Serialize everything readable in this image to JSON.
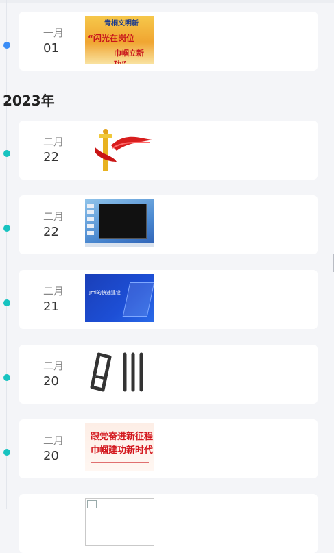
{
  "year_heading": "2023年",
  "entries": [
    {
      "month": "一月",
      "day": "01",
      "thumb": "poster-flash-post",
      "thumb_text_top": "青桐文明新",
      "thumb_text_main1": "“闪光在岗位",
      "thumb_text_main2": "巾帼立新功”"
    },
    {
      "month": "二月",
      "day": "22",
      "thumb": "huabiao-ribbon-icon"
    },
    {
      "month": "二月",
      "day": "22",
      "thumb": "desktop-terminal-screenshot"
    },
    {
      "month": "二月",
      "day": "21",
      "thumb": "blue-presentation-slide",
      "thumb_text": "Jmi的快速建设"
    },
    {
      "month": "二月",
      "day": "20",
      "thumb": "books-icon"
    },
    {
      "month": "二月",
      "day": "20",
      "thumb": "red-banner-poster",
      "thumb_text_line1": "跟党奋进新征程",
      "thumb_text_line2": "巾帼建功新时代"
    },
    {
      "month": "",
      "day": "",
      "thumb": "broken-image-icon"
    }
  ],
  "colors": {
    "accent_blue": "#3b8df6",
    "accent_teal": "#17c3c0"
  }
}
